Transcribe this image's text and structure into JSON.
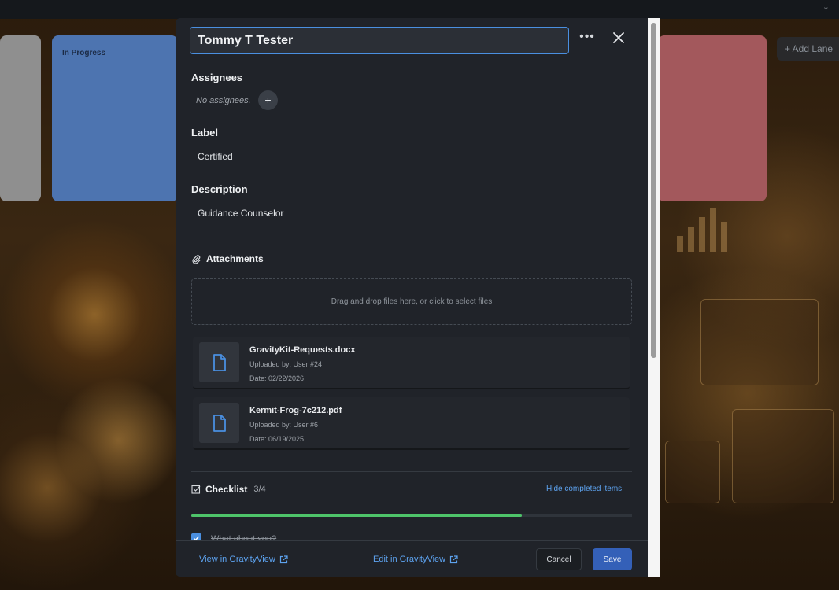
{
  "board": {
    "lane_in_progress": "In Progress",
    "add_lane": "+ Add Lane"
  },
  "card": {
    "title": "Tommy T Tester",
    "assignees_heading": "Assignees",
    "no_assignees": "No assignees.",
    "add_assignee": "+",
    "label_heading": "Label",
    "label_value": "Certified",
    "description_heading": "Description",
    "description_value": "Guidance Counselor",
    "attachments_heading": "Attachments",
    "dropzone_text": "Drag and drop files here, or click to select files",
    "attachments": [
      {
        "name": "GravityKit-Requests.docx",
        "uploaded_by": "Uploaded by: User #24",
        "date": "Date: 02/22/2026"
      },
      {
        "name": "Kermit-Frog-7c212.pdf",
        "uploaded_by": "Uploaded by: User #6",
        "date": "Date: 06/19/2025"
      }
    ],
    "checklist_heading": "Checklist",
    "checklist_count": "3/4",
    "checklist_progress": 0.75,
    "hide_completed": "Hide completed items",
    "checklist_items": [
      {
        "label": "What about you?",
        "checked": true
      }
    ]
  },
  "footer": {
    "view_link": "View in GravityView",
    "edit_link": "Edit in GravityView",
    "cancel": "Cancel",
    "save": "Save"
  },
  "colors": {
    "accent": "#4a8fe0",
    "link": "#5da3f0",
    "progress": "#4ec46a",
    "save_button": "#3460b8"
  }
}
